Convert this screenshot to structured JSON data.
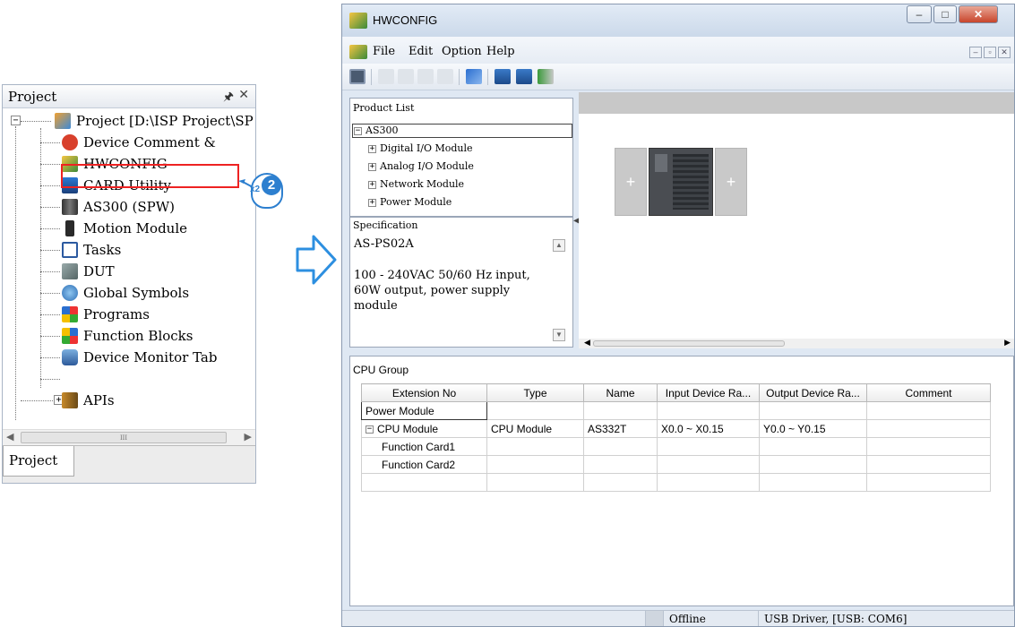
{
  "project_panel": {
    "title": "Project",
    "items": [
      {
        "label": "Project [D:\\ISP Project\\SP",
        "icon": "project-icon"
      },
      {
        "label": "Device Comment &",
        "icon": "device-comment-icon"
      },
      {
        "label": "HWCONFIG",
        "icon": "hwconfig-icon"
      },
      {
        "label": "CARD Utility",
        "icon": "card-utility-icon"
      },
      {
        "label": "AS300  (SPW)",
        "icon": "plc-icon"
      },
      {
        "label": "Motion Module",
        "icon": "motion-module-icon"
      },
      {
        "label": "Tasks",
        "icon": "tasks-icon"
      },
      {
        "label": "DUT",
        "icon": "dut-icon"
      },
      {
        "label": "Global Symbols",
        "icon": "global-symbols-icon"
      },
      {
        "label": "Programs",
        "icon": "programs-icon"
      },
      {
        "label": "Function Blocks",
        "icon": "function-blocks-icon"
      },
      {
        "label": "Device Monitor Tab",
        "icon": "device-monitor-icon"
      },
      {
        "label": "APIs",
        "icon": "apis-icon"
      }
    ],
    "tab_label": "Project",
    "scroll_thumb_text": "III"
  },
  "callout": {
    "step_number": "2",
    "click_count": "x2"
  },
  "hwconfig": {
    "window_title": "HWCONFIG",
    "menu": [
      "File",
      "Edit",
      "Option",
      "Help"
    ],
    "product_list": {
      "title": "Product List",
      "root": "AS300",
      "children": [
        "Digital I/O Module",
        "Analog I/O Module",
        "Network Module",
        "Power Module"
      ]
    },
    "specification": {
      "title": "Specification",
      "model": "AS-PS02A",
      "description": "100 - 240VAC 50/60 Hz input, 60W output, power supply module"
    },
    "cpu_group": {
      "title": "CPU Group",
      "columns": [
        "Extension No",
        "Type",
        "Name",
        "Input Device Ra...",
        "Output Device Ra...",
        "Comment"
      ],
      "rows": [
        [
          "Power Module",
          "",
          "",
          "",
          "",
          ""
        ],
        [
          "CPU Module",
          "CPU Module",
          "AS332T",
          "X0.0 ~ X0.15",
          "Y0.0 ~ Y0.15",
          ""
        ],
        [
          "Function Card1",
          "",
          "",
          "",
          "",
          ""
        ],
        [
          "Function Card2",
          "",
          "",
          "",
          "",
          ""
        ],
        [
          "",
          "",
          "",
          "",
          "",
          ""
        ]
      ]
    },
    "status": {
      "mode": "Offline",
      "connection": "USB Driver, [USB: COM6]"
    }
  },
  "colors": {
    "highlight": "#e22222",
    "accent_blue": "#2d7fcf",
    "window_bg": "#dfe8f3"
  }
}
